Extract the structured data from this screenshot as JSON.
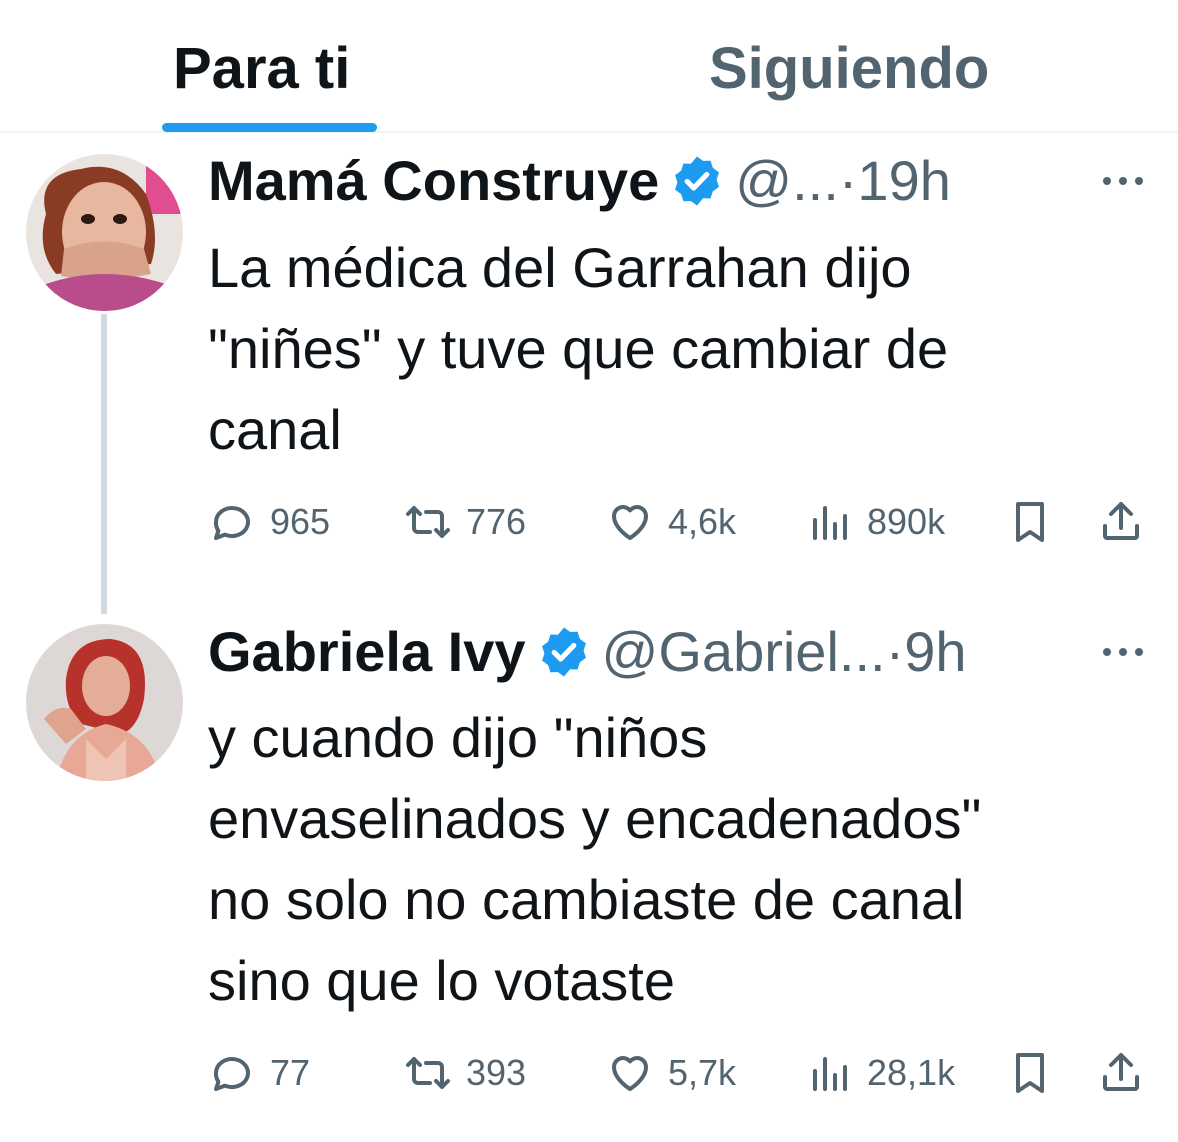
{
  "tabs": [
    {
      "label": "Para ti",
      "active": true
    },
    {
      "label": "Siguiendo",
      "active": false
    }
  ],
  "colors": {
    "accent": "#1d9bf0",
    "text_primary": "#0f1419",
    "text_secondary": "#536471",
    "divider": "#eff3f4",
    "thread_line": "#cfd9de"
  },
  "tweets": [
    {
      "name": "Mamá Construye",
      "verified": true,
      "handle": "@...",
      "separator": "·",
      "time": "19h",
      "text": "La médica del Garrahan dijo\n\"niñes\" y tuve que cambiar de\ncanal",
      "stats": {
        "replies": "965",
        "retweets": "776",
        "likes": "4,6k",
        "views": "890k"
      }
    },
    {
      "name": "Gabriela Ivy",
      "verified": true,
      "handle": "@Gabriel...",
      "separator": "·",
      "time": "9h",
      "text": "y cuando dijo \"niños\nenvaselinados y encadenados\"\nno solo no cambiaste de canal\nsino que lo votaste",
      "stats": {
        "replies": "77",
        "retweets": "393",
        "likes": "5,7k",
        "views": "28,1k"
      }
    }
  ],
  "icons": {
    "reply": "speech-bubble-icon",
    "retweet": "retweet-icon",
    "like": "heart-icon",
    "views": "bar-chart-icon",
    "bookmark": "bookmark-icon",
    "share": "share-icon",
    "verified": "verified-badge-icon",
    "more": "more-dots-icon"
  }
}
